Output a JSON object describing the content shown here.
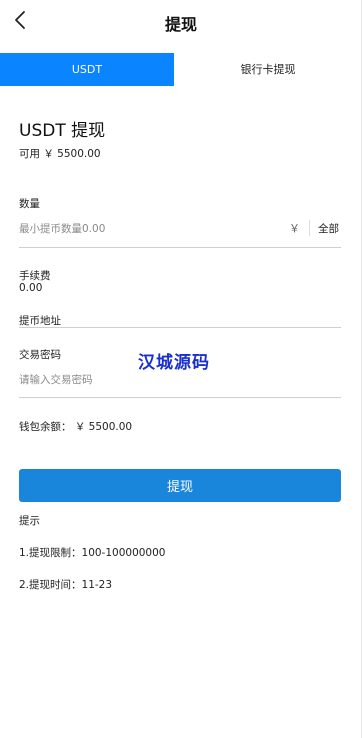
{
  "header": {
    "title": "提现",
    "back_icon": "chevron-left-icon"
  },
  "tabs": [
    {
      "label": "USDT",
      "active": true
    },
    {
      "label": "银行卡提现",
      "active": false
    }
  ],
  "form": {
    "section_title": "USDT 提现",
    "available": "可用 ￥ 5500.00",
    "amount_label": "数量",
    "amount_placeholder": "最小提币数量0.00",
    "currency_symbol": "￥",
    "all_label": "全部",
    "fee_label": "手续费",
    "fee_value": "0.00",
    "address_label": "提币地址",
    "password_label": "交易密码",
    "password_placeholder": "请输入交易密码",
    "balance": "钱包余额： ￥ 5500.00",
    "submit_label": "提现"
  },
  "watermark": "汉城源码",
  "tips": {
    "title": "提示",
    "items": [
      "1.提现限制：100-100000000",
      "2.提现时间：11-23"
    ]
  },
  "colors": {
    "accent": "#0a84ff",
    "button": "#1a86db",
    "watermark": "#1a2fd0"
  }
}
